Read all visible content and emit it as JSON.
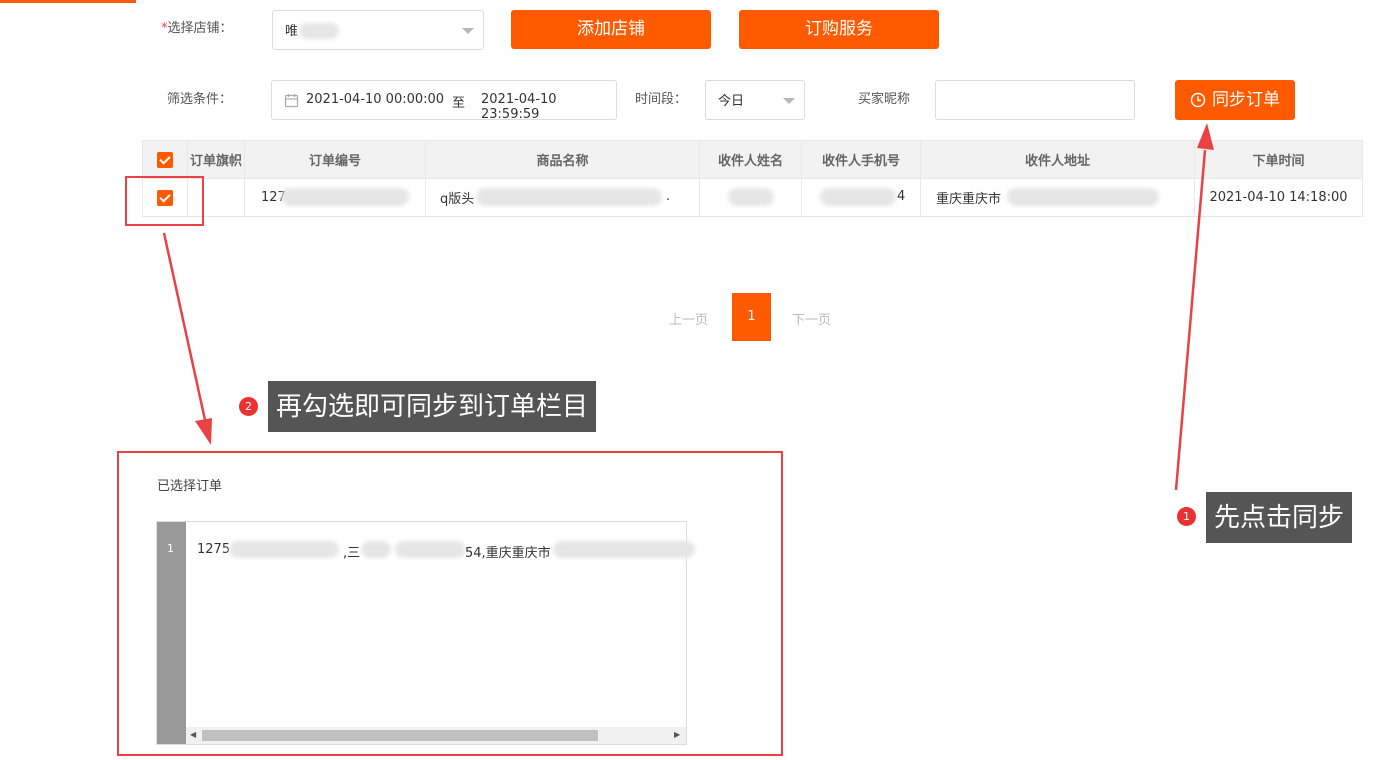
{
  "form": {
    "store_label": "选择店铺：",
    "store_required_mark": "*",
    "store_value": "唯",
    "add_store_button": "添加店铺",
    "order_service_button": "订购服务",
    "filter_label": "筛选条件：",
    "date_start": "2021-04-10 00:00:00",
    "date_sep": "至",
    "date_end": "2021-04-10 23:59:59",
    "period_label": "时间段：",
    "period_value": "今日",
    "buyer_label": "买家昵称",
    "buyer_value": "",
    "sync_button": "同步订单"
  },
  "table": {
    "headers": [
      "订单旗帜",
      "订单编号",
      "商品名称",
      "收件人姓名",
      "收件人手机号",
      "收件人地址",
      "下单时间"
    ],
    "rows": [
      {
        "order_no": "127",
        "product": "q版头",
        "product_tail": ".",
        "phone_tail": "4",
        "address": "重庆重庆市",
        "time": "2021-04-10 14:18:00"
      }
    ]
  },
  "pager": {
    "prev": "上一页",
    "current": "1",
    "next": "下一页"
  },
  "annotations": {
    "step1_num": "1",
    "step1_text": "先点击同步",
    "step2_num": "2",
    "step2_text": "再勾选即可同步到订单栏目"
  },
  "selected": {
    "title": "已选择订单",
    "line_number": "1",
    "line_a": "1275",
    "line_b": ",三",
    "line_c": "54,重庆重庆市"
  },
  "colors": {
    "accent": "#ff5a00",
    "annotation_red": "#e94144",
    "note_bg": "#555555"
  }
}
